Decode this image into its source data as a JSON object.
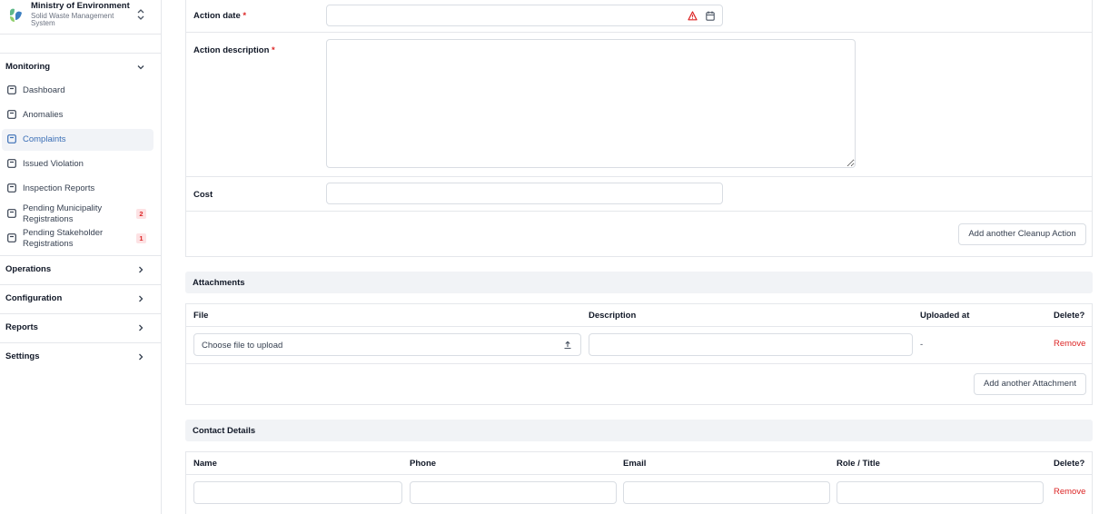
{
  "brand": {
    "title": "Ministry of Environment",
    "subtitle": "Solid Waste Management System"
  },
  "sidebar": {
    "monitoring": {
      "label": "Monitoring",
      "items": [
        {
          "label": "Dashboard"
        },
        {
          "label": "Anomalies"
        },
        {
          "label": "Complaints"
        },
        {
          "label": "Issued Violation"
        },
        {
          "label": "Inspection Reports"
        },
        {
          "label": "Pending Municipality Registrations",
          "badge": "2"
        },
        {
          "label": "Pending Stakeholder Registrations",
          "badge": "1"
        }
      ]
    },
    "operations": "Operations",
    "configuration": "Configuration",
    "reports": "Reports",
    "settings": "Settings"
  },
  "cleanup": {
    "action_date_label": "Action date",
    "action_description_label": "Action description",
    "required_mark": "*",
    "cost_label": "Cost",
    "add_button": "Add another Cleanup Action"
  },
  "attachments": {
    "title": "Attachments",
    "columns": [
      "File",
      "Description",
      "Uploaded at",
      "Delete?"
    ],
    "row": {
      "file_placeholder": "Choose file to upload",
      "uploaded_at": "-",
      "remove": "Remove"
    },
    "add_button": "Add another Attachment"
  },
  "contacts": {
    "title": "Contact Details",
    "columns": [
      "Name",
      "Phone",
      "Email",
      "Role / Title",
      "Delete?"
    ],
    "row": {
      "remove": "Remove"
    }
  },
  "colors": {
    "accent": "#3b6fb6",
    "danger": "#dc2626",
    "section_bg": "#f1f3f6"
  }
}
